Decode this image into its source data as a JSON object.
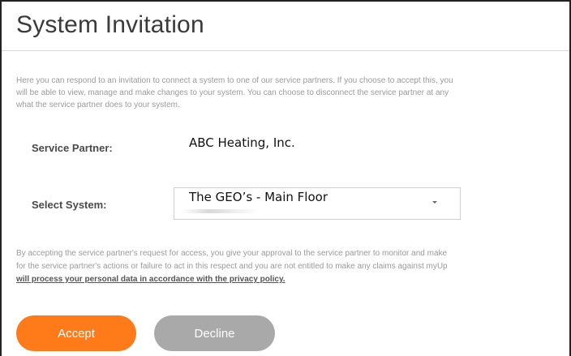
{
  "page": {
    "title": "System Invitation"
  },
  "intro": {
    "line1": "Here you can respond to an invitation to connect a system to one of our service partners. If you choose to accept this, you",
    "line2": "will be able to view, manage and make changes to your system. You can choose to disconnect the service partner at any",
    "line3": "what the service partner does to your system."
  },
  "fields": {
    "service_partner_label": "Service Partner:",
    "service_partner_value": "ABC Heating, Inc.",
    "select_system_label": "Select System:",
    "select_system_value": "The GEO’s - Main Floor"
  },
  "consent": {
    "line1": "By accepting the service partner's request for access, you give your approval to the service partner to monitor and make",
    "line2": "for the service partner's actions or failure to act in this respect and you are not entitled to make any claims against myUp",
    "privacy_link": "will process your personal data in accordance with the privacy policy."
  },
  "actions": {
    "accept_label": "Accept",
    "decline_label": "Decline"
  },
  "colors": {
    "accent": "#ff7b19",
    "decline": "#a9a9a9"
  },
  "icons": {
    "select_toggle": "chevron-down-icon"
  }
}
